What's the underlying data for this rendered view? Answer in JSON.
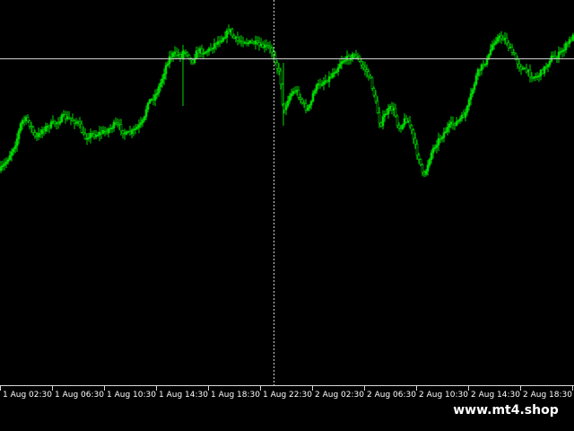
{
  "chart_data": {
    "type": "candlestick",
    "title": "",
    "xlabel": "",
    "ylabel": "",
    "x_tick_labels": [
      "1 Aug 02:30",
      "1 Aug 06:30",
      "1 Aug 10:30",
      "1 Aug 14:30",
      "1 Aug 18:30",
      "1 Aug 22:30",
      "2 Aug 02:30",
      "2 Aug 06:30",
      "2 Aug 10:30",
      "2 Aug 14:30",
      "2 Aug 18:30",
      "2 A"
    ],
    "y_axis_visible": false,
    "grid": false,
    "crosshair": {
      "time_label": "1 Aug 22:30",
      "style": "dotted vertical + solid horizontal"
    },
    "close_path": [
      [
        0,
        190
      ],
      [
        6,
        182
      ],
      [
        12,
        170
      ],
      [
        18,
        158
      ],
      [
        24,
        135
      ],
      [
        30,
        133
      ],
      [
        34,
        140
      ],
      [
        40,
        155
      ],
      [
        46,
        145
      ],
      [
        52,
        142
      ],
      [
        58,
        138
      ],
      [
        64,
        136
      ],
      [
        70,
        130
      ],
      [
        76,
        132
      ],
      [
        82,
        134
      ],
      [
        88,
        138
      ],
      [
        94,
        154
      ],
      [
        100,
        150
      ],
      [
        106,
        150
      ],
      [
        112,
        148
      ],
      [
        118,
        146
      ],
      [
        124,
        142
      ],
      [
        128,
        138
      ],
      [
        134,
        142
      ],
      [
        140,
        150
      ],
      [
        146,
        148
      ],
      [
        152,
        143
      ],
      [
        158,
        138
      ],
      [
        162,
        130
      ],
      [
        164,
        112
      ],
      [
        168,
        112
      ],
      [
        172,
        108
      ],
      [
        176,
        100
      ],
      [
        180,
        90
      ],
      [
        186,
        70
      ],
      [
        190,
        62
      ],
      [
        196,
        60
      ],
      [
        202,
        62
      ],
      [
        206,
        56
      ],
      [
        210,
        60
      ],
      [
        214,
        70
      ],
      [
        218,
        60
      ],
      [
        222,
        56
      ],
      [
        228,
        58
      ],
      [
        234,
        55
      ],
      [
        240,
        48
      ],
      [
        246,
        44
      ],
      [
        252,
        38
      ],
      [
        256,
        32
      ],
      [
        260,
        42
      ],
      [
        266,
        46
      ],
      [
        272,
        45
      ],
      [
        278,
        48
      ],
      [
        284,
        48
      ],
      [
        290,
        52
      ],
      [
        298,
        52
      ],
      [
        304,
        58
      ],
      [
        306,
        62
      ],
      [
        308,
        72
      ],
      [
        312,
        84
      ],
      [
        314,
        100
      ],
      [
        316,
        128
      ],
      [
        320,
        112
      ],
      [
        324,
        105
      ],
      [
        330,
        100
      ],
      [
        334,
        108
      ],
      [
        338,
        116
      ],
      [
        342,
        122
      ],
      [
        346,
        118
      ],
      [
        350,
        100
      ],
      [
        356,
        94
      ],
      [
        362,
        90
      ],
      [
        368,
        86
      ],
      [
        372,
        80
      ],
      [
        376,
        76
      ],
      [
        380,
        68
      ],
      [
        386,
        66
      ],
      [
        392,
        62
      ],
      [
        398,
        62
      ],
      [
        402,
        72
      ],
      [
        408,
        78
      ],
      [
        412,
        86
      ],
      [
        416,
        100
      ],
      [
        420,
        120
      ],
      [
        424,
        140
      ],
      [
        428,
        130
      ],
      [
        432,
        124
      ],
      [
        436,
        120
      ],
      [
        440,
        124
      ],
      [
        444,
        142
      ],
      [
        448,
        140
      ],
      [
        452,
        132
      ],
      [
        456,
        136
      ],
      [
        460,
        150
      ],
      [
        464,
        168
      ],
      [
        468,
        178
      ],
      [
        472,
        200
      ],
      [
        476,
        186
      ],
      [
        480,
        172
      ],
      [
        486,
        160
      ],
      [
        492,
        152
      ],
      [
        498,
        144
      ],
      [
        504,
        138
      ],
      [
        510,
        136
      ],
      [
        516,
        130
      ],
      [
        520,
        124
      ],
      [
        524,
        110
      ],
      [
        528,
        96
      ],
      [
        532,
        82
      ],
      [
        536,
        76
      ],
      [
        540,
        70
      ],
      [
        544,
        66
      ],
      [
        548,
        52
      ],
      [
        552,
        44
      ],
      [
        556,
        42
      ],
      [
        560,
        42
      ],
      [
        564,
        44
      ],
      [
        568,
        54
      ],
      [
        572,
        60
      ],
      [
        576,
        68
      ],
      [
        580,
        74
      ],
      [
        584,
        78
      ],
      [
        588,
        80
      ],
      [
        592,
        84
      ],
      [
        596,
        86
      ],
      [
        600,
        84
      ],
      [
        604,
        80
      ],
      [
        610,
        72
      ],
      [
        614,
        64
      ],
      [
        620,
        64
      ],
      [
        626,
        58
      ],
      [
        630,
        52
      ],
      [
        636,
        44
      ],
      [
        640,
        40
      ]
    ]
  },
  "watermark": {
    "text": "www.mt4.shop"
  },
  "colors": {
    "background": "#000000",
    "candle": "#00d800",
    "axis_text": "#ffffff",
    "grid_line": "#d0d0d0",
    "frame": "#d8d8d8"
  }
}
